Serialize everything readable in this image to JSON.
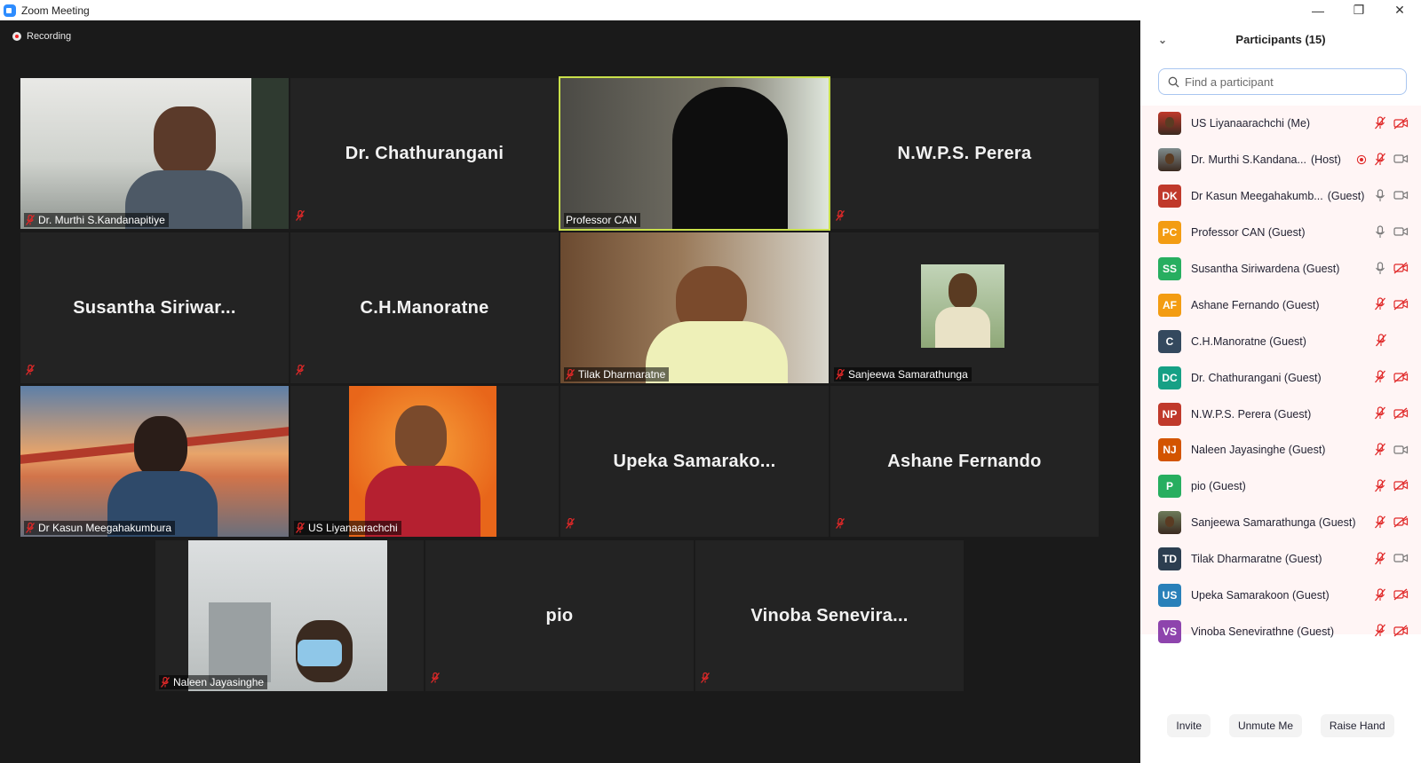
{
  "window": {
    "title": "Zoom Meeting"
  },
  "recording": {
    "label": "Recording"
  },
  "gallery": [
    {
      "display": "Dr. Murthi S.Kandanapitiye",
      "label": "Dr. Murthi S.Kandanapitiye",
      "video": true
    },
    {
      "display": "Dr. Chathurangani",
      "label": "",
      "video": false
    },
    {
      "display": "Professor CAN",
      "label": "Professor CAN",
      "video": true,
      "active": true
    },
    {
      "display": "N.W.P.S. Perera",
      "label": "",
      "video": false
    },
    {
      "display": "Susantha  Siriwar...",
      "label": "",
      "video": false
    },
    {
      "display": "C.H.Manoratne",
      "label": "",
      "video": false
    },
    {
      "display": "Tilak Dharmaratne",
      "label": "Tilak Dharmaratne",
      "video": true
    },
    {
      "display": "Sanjeewa Samarathunga",
      "label": "Sanjeewa Samarathunga",
      "video": true
    },
    {
      "display": "Dr Kasun Meegahakumbura",
      "label": "Dr Kasun Meegahakumbura",
      "video": true
    },
    {
      "display": "US Liyanaarachchi",
      "label": "US Liyanaarachchi",
      "video": true
    },
    {
      "display": "Upeka  Samarako...",
      "label": "",
      "video": false
    },
    {
      "display": "Ashane Fernando",
      "label": "",
      "video": false
    },
    {
      "display": "Naleen Jayasinghe",
      "label": "Naleen Jayasinghe",
      "video": true
    },
    {
      "display": "pio",
      "label": "",
      "video": false
    },
    {
      "display": "Vinoba  Senevira...",
      "label": "",
      "video": false
    }
  ],
  "panel": {
    "title": "Participants (15)",
    "search_placeholder": "Find a participant",
    "participants": [
      {
        "initials": "",
        "photo": true,
        "color": "#c0392b",
        "name": "US Liyanaarachchi (Me)",
        "tag": "",
        "mic": "muted",
        "cam": "off"
      },
      {
        "initials": "",
        "photo": true,
        "color": "#7f8c8d",
        "name": "Dr. Murthi S.Kandana...",
        "tag": "(Host)",
        "mic": "muted",
        "cam": "on",
        "recording": true
      },
      {
        "initials": "DK",
        "photo": false,
        "color": "#c0392b",
        "name": "Dr Kasun Meegahakumb...",
        "tag": "(Guest)",
        "mic": "on",
        "cam": "on"
      },
      {
        "initials": "PC",
        "photo": false,
        "color": "#f39c12",
        "name": "Professor CAN (Guest)",
        "tag": "",
        "mic": "on",
        "cam": "on"
      },
      {
        "initials": "SS",
        "photo": false,
        "color": "#27ae60",
        "name": "Susantha Siriwardena (Guest)",
        "tag": "",
        "mic": "on",
        "cam": "off"
      },
      {
        "initials": "AF",
        "photo": false,
        "color": "#f39c12",
        "name": "Ashane Fernando (Guest)",
        "tag": "",
        "mic": "muted",
        "cam": "off"
      },
      {
        "initials": "C",
        "photo": false,
        "color": "#34495e",
        "name": "C.H.Manoratne (Guest)",
        "tag": "",
        "mic": "muted",
        "cam": "none"
      },
      {
        "initials": "DC",
        "photo": false,
        "color": "#16a085",
        "name": "Dr. Chathurangani (Guest)",
        "tag": "",
        "mic": "muted",
        "cam": "off"
      },
      {
        "initials": "NP",
        "photo": false,
        "color": "#c0392b",
        "name": "N.W.P.S. Perera (Guest)",
        "tag": "",
        "mic": "muted",
        "cam": "off"
      },
      {
        "initials": "NJ",
        "photo": false,
        "color": "#d35400",
        "name": "Naleen Jayasinghe (Guest)",
        "tag": "",
        "mic": "muted",
        "cam": "on"
      },
      {
        "initials": "P",
        "photo": false,
        "color": "#27ae60",
        "name": "pio (Guest)",
        "tag": "",
        "mic": "muted",
        "cam": "off"
      },
      {
        "initials": "",
        "photo": true,
        "color": "#6d7b5a",
        "name": "Sanjeewa Samarathunga (Guest)",
        "tag": "",
        "mic": "muted",
        "cam": "off"
      },
      {
        "initials": "TD",
        "photo": false,
        "color": "#2c3e50",
        "name": "Tilak Dharmaratne (Guest)",
        "tag": "",
        "mic": "muted",
        "cam": "on"
      },
      {
        "initials": "US",
        "photo": false,
        "color": "#2980b9",
        "name": "Upeka Samarakoon (Guest)",
        "tag": "",
        "mic": "muted",
        "cam": "off"
      },
      {
        "initials": "VS",
        "photo": false,
        "color": "#8e44ad",
        "name": "Vinoba Senevirathne (Guest)",
        "tag": "",
        "mic": "muted",
        "cam": "off"
      }
    ],
    "buttons": {
      "invite": "Invite",
      "unmute": "Unmute Me",
      "raise_hand": "Raise Hand"
    }
  },
  "colors": {
    "active_speaker": "#c9e04a",
    "mute_red": "#e02828",
    "accent": "#2d8cff"
  }
}
